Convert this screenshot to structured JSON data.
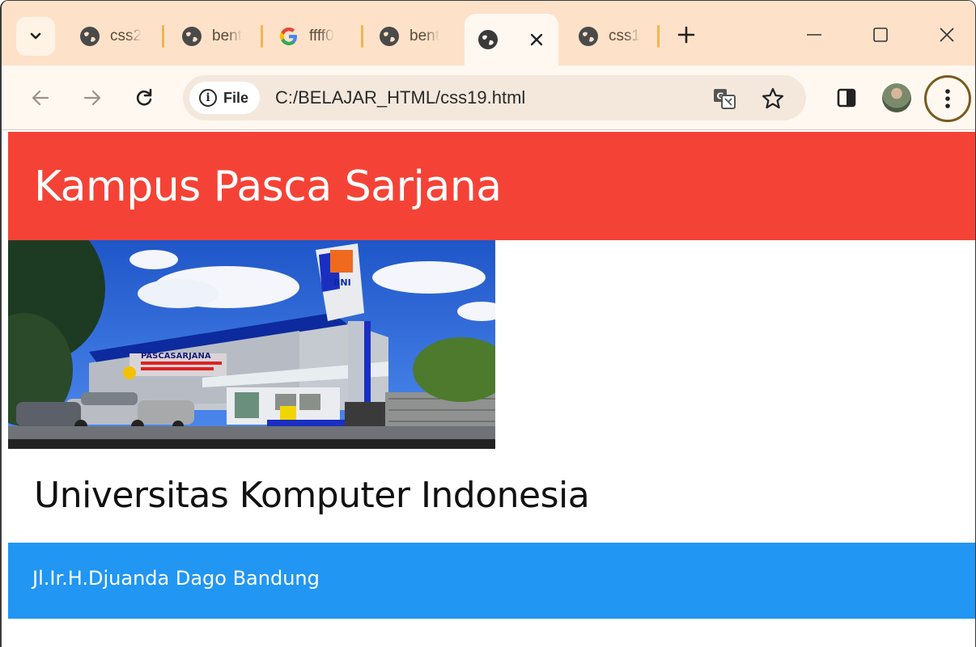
{
  "browser": {
    "tabs": [
      {
        "title": "css2",
        "icon": "globe-icon"
      },
      {
        "title": "bent",
        "icon": "globe-icon"
      },
      {
        "title": "ffff0",
        "icon": "google-icon"
      },
      {
        "title": "bent",
        "icon": "globe-icon"
      },
      {
        "title": "",
        "icon": "globe-icon",
        "active": true
      },
      {
        "title": "css1",
        "icon": "globe-icon"
      }
    ],
    "address": {
      "chip_label": "File",
      "url": "C:/BELAJAR_HTML/css19.html"
    },
    "colors": {
      "tabstrip": "#fde2c9",
      "toolbar": "#fff8f1",
      "tab_separator": "#f2b451"
    }
  },
  "page": {
    "header_title": "Kampus Pasca Sarjana",
    "university": "Universitas Komputer Indonesia",
    "address": "Jl.Ir.H.Djuanda Dago Bandung",
    "colors": {
      "header": "#f44336",
      "footer": "#2196f3"
    },
    "image_text": {
      "building_sign": "PASCASARJANA",
      "bank_sign": "BNI"
    }
  }
}
